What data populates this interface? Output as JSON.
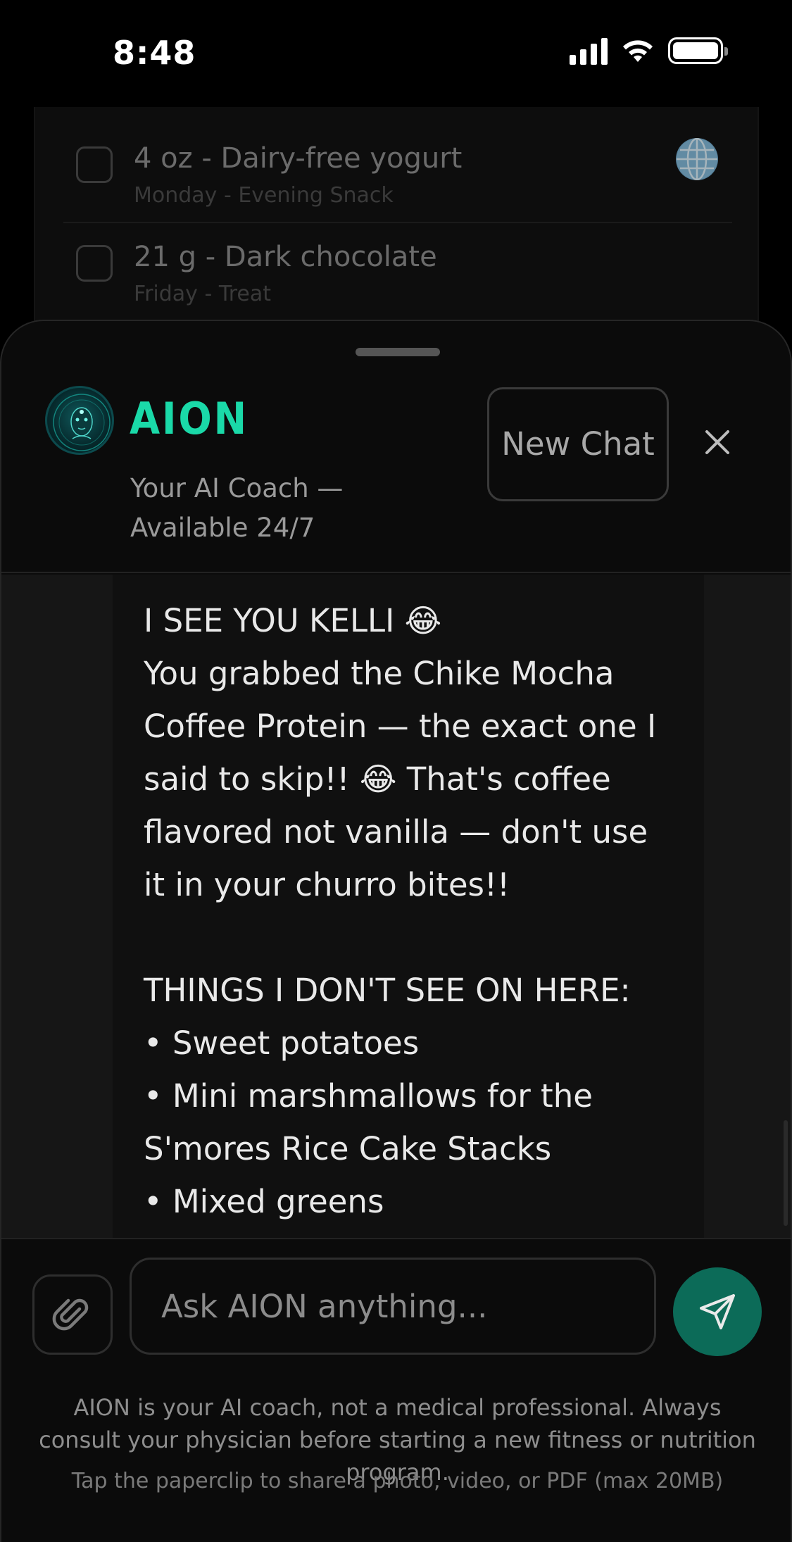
{
  "status_bar": {
    "time": "8:48"
  },
  "background_list": {
    "items": [
      {
        "title": "4 oz - Dairy-free yogurt",
        "subtitle": "Monday - Evening Snack",
        "icon": "globe-icon"
      },
      {
        "title": "21 g - Dark chocolate",
        "subtitle": "Friday - Treat"
      }
    ]
  },
  "chat": {
    "brand": "AION",
    "tagline": "Your AI Coach — Available 24/7",
    "new_chat_label": "New Chat",
    "message": "I SEE YOU KELLI 😂\nYou grabbed the Chike Mocha Coffee Protein — the exact one I said to skip!! 😂 That's coffee flavored not vanilla — don't use it in your churro bites!!\n\nTHINGS I DON'T SEE ON HERE:\n• Sweet potatoes\n• Mini marshmallows for the S'mores Rice Cake Stacks\n• Mixed greens",
    "input_placeholder": "Ask AION anything...",
    "disclaimer": "AION is your AI coach, not a medical professional. Always consult your physician before starting a new fitness or nutrition program.",
    "hint": "Tap the paperclip to share a photo, video, or PDF (max 20MB)"
  },
  "colors": {
    "accent": "#1ad9a8",
    "send_button": "#0c6b58",
    "background": "#000000"
  }
}
